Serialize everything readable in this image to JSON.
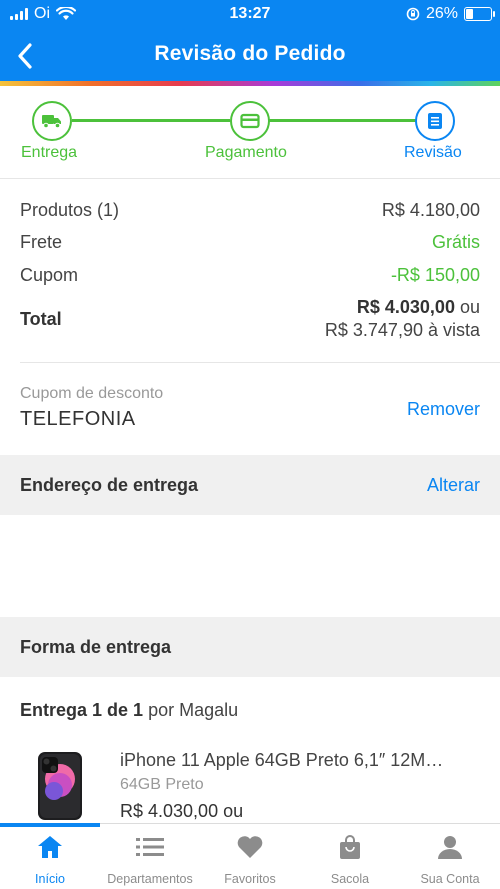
{
  "status_bar": {
    "carrier": "Oi",
    "time": "13:27",
    "battery": "26%",
    "battery_level": 0.26
  },
  "header": {
    "title": "Revisão do Pedido"
  },
  "stepper": {
    "steps": [
      {
        "label": "Entrega",
        "icon": "truck-icon",
        "state": "done"
      },
      {
        "label": "Pagamento",
        "icon": "card-icon",
        "state": "done"
      },
      {
        "label": "Revisão",
        "icon": "list-icon",
        "state": "current"
      }
    ]
  },
  "summary": {
    "products_label": "Produtos (1)",
    "products_value": "R$ 4.180,00",
    "shipping_label": "Frete",
    "shipping_value": "Grátis",
    "coupon_label": "Cupom",
    "coupon_value": "-R$ 150,00",
    "total_label": "Total",
    "total_value": "R$ 4.030,00",
    "total_or": "ou",
    "total_cash": "R$ 3.747,90 à vista"
  },
  "coupon": {
    "caption": "Cupom de desconto",
    "code": "TELEFONIA",
    "remove_label": "Remover"
  },
  "address": {
    "title": "Endereço de entrega",
    "change_label": "Alterar"
  },
  "shipping_method": {
    "title": "Forma de entrega"
  },
  "delivery": {
    "label": "Entrega 1 de 1",
    "by": "por Magalu"
  },
  "product": {
    "name": "iPhone 11 Apple 64GB Preto 6,1″ 12M…",
    "variant": "64GB Preto",
    "price": "R$ 4.030,00 ou",
    "image": "iphone-image"
  },
  "tabs": [
    {
      "label": "Início",
      "icon": "home-icon",
      "active": true
    },
    {
      "label": "Departamentos",
      "icon": "menu-icon",
      "active": false
    },
    {
      "label": "Favoritos",
      "icon": "heart-icon",
      "active": false
    },
    {
      "label": "Sacola",
      "icon": "bag-icon",
      "active": false
    },
    {
      "label": "Sua Conta",
      "icon": "user-icon",
      "active": false
    }
  ],
  "colors": {
    "brand_blue": "#0a86f2",
    "success_green": "#4cc13b",
    "section_gray": "#f0f0f0"
  }
}
